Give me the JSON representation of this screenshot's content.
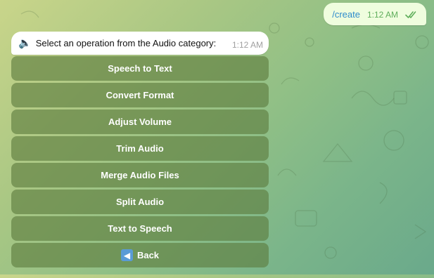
{
  "outgoing": {
    "text": "/create",
    "time": "1:12 AM",
    "status_icon": "double-check-icon"
  },
  "incoming": {
    "icon": "speaker-icon",
    "text": "Select an operation from the Audio category:",
    "time": "1:12 AM"
  },
  "keyboard": {
    "buttons": [
      {
        "label": "Speech to Text"
      },
      {
        "label": "Convert Format"
      },
      {
        "label": "Adjust Volume"
      },
      {
        "label": "Trim Audio"
      },
      {
        "label": "Merge Audio Files"
      },
      {
        "label": "Split Audio"
      },
      {
        "label": "Text to Speech"
      },
      {
        "label": "Back",
        "icon": "back-arrow-icon"
      }
    ]
  },
  "colors": {
    "outgoing_bubble": "#effdde",
    "link": "#2e8bcc",
    "keyboard_button": "#5c7a3e"
  }
}
